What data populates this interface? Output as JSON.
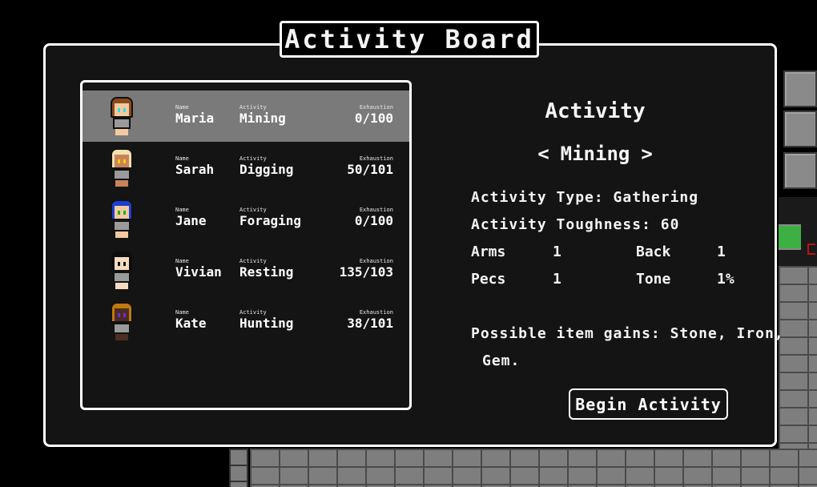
{
  "window": {
    "title": "Activity Board"
  },
  "roster": {
    "label_name": "Name",
    "label_activity": "Activity",
    "label_exhaustion": "Exhaustion",
    "rows": [
      {
        "name": "Maria",
        "activity": "Mining",
        "exhaustion": "0/100",
        "selected": true,
        "hair": "#8b4a1c",
        "skin": "#f5c9a0",
        "eyes": "#30e0e8"
      },
      {
        "name": "Sarah",
        "activity": "Digging",
        "exhaustion": "50/101",
        "selected": false,
        "hair": "#f2e2b0",
        "skin": "#c9835a",
        "eyes": "#f0d000"
      },
      {
        "name": "Jane",
        "activity": "Foraging",
        "exhaustion": "0/100",
        "selected": false,
        "hair": "#1a3fd0",
        "skin": "#f5c9a0",
        "eyes": "#20b020"
      },
      {
        "name": "Vivian",
        "activity": "Resting",
        "exhaustion": "135/103",
        "selected": false,
        "hair": "#0c0c0c",
        "skin": "#f5dcc0",
        "eyes": "#111111"
      },
      {
        "name": "Kate",
        "activity": "Hunting",
        "exhaustion": "38/101",
        "selected": false,
        "hair": "#c07810",
        "skin": "#4a2e22",
        "eyes": "#8020e0"
      }
    ]
  },
  "detail": {
    "heading": "Activity",
    "selector": {
      "prev_icon": "<",
      "current": "Mining",
      "next_icon": ">"
    },
    "type_line": "Activity Type: Gathering",
    "toughness_line": "Activity Toughness: 60",
    "stats": [
      {
        "label": "Arms",
        "value": "1"
      },
      {
        "label": "Back",
        "value": "1"
      },
      {
        "label": "Pecs",
        "value": "1"
      },
      {
        "label": "Tone",
        "value": "1%"
      }
    ],
    "gains_line1": "Possible item gains: Stone, Iron,",
    "gains_line2": "Gem.",
    "begin_button": "Begin Activity"
  }
}
